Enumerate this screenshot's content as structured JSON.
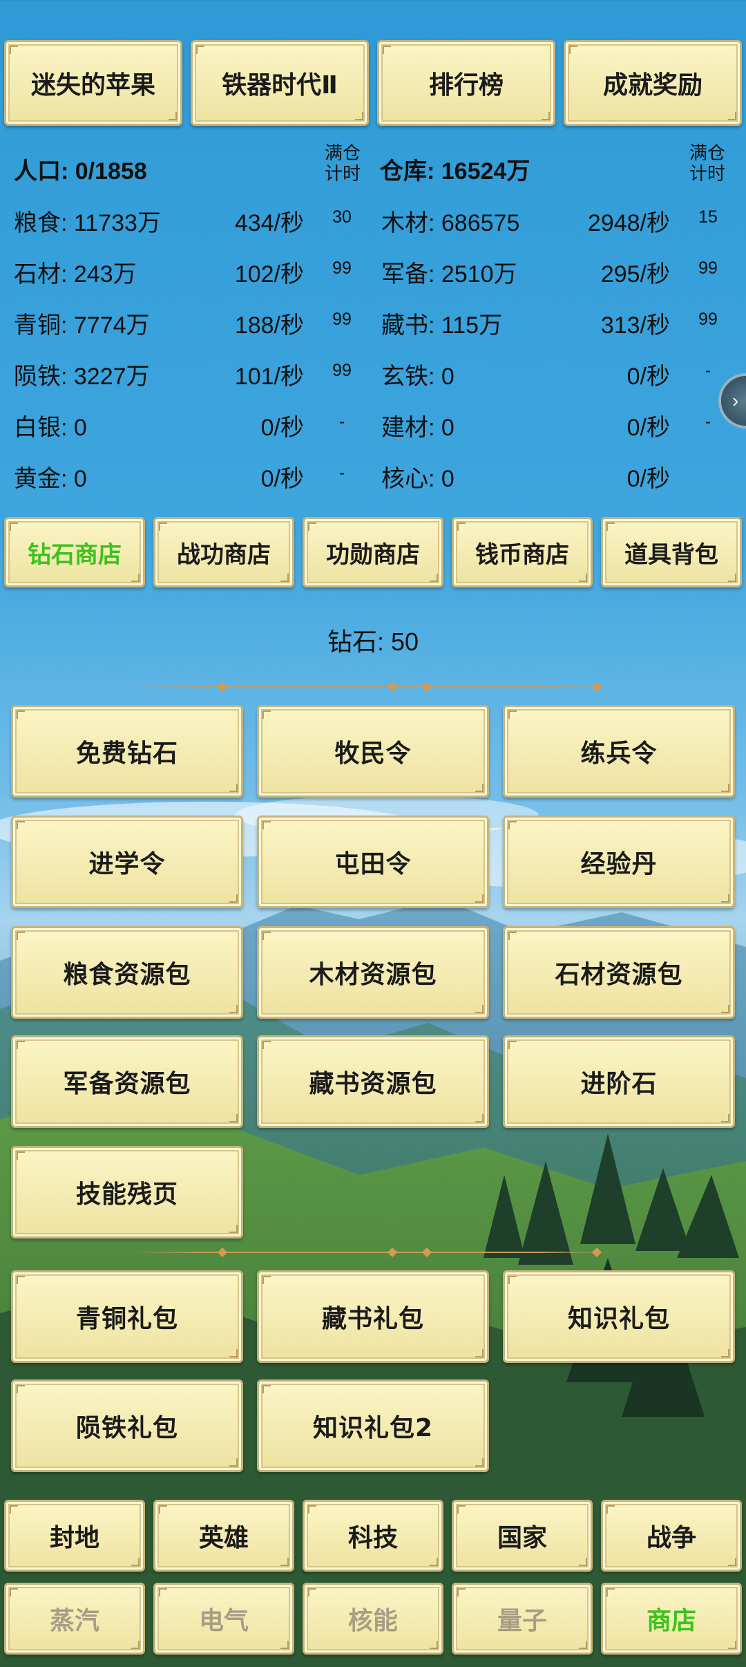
{
  "top_tabs": [
    "迷失的苹果",
    "铁器时代Ⅱ",
    "排行榜",
    "成就奖励"
  ],
  "resources": {
    "left_header": {
      "label": "人口: 0/1858",
      "cap_label": "满仓\n计时"
    },
    "right_header": {
      "label": "仓库: 16524万",
      "cap_label": "满仓\n计时"
    },
    "left": [
      {
        "name": "粮食: 11733万",
        "rate": "434/秒",
        "timer": "30"
      },
      {
        "name": "石材: 243万",
        "rate": "102/秒",
        "timer": "99"
      },
      {
        "name": "青铜: 7774万",
        "rate": "188/秒",
        "timer": "99"
      },
      {
        "name": "陨铁: 3227万",
        "rate": "101/秒",
        "timer": "99"
      },
      {
        "name": "白银: 0",
        "rate": "0/秒",
        "timer": "-"
      },
      {
        "name": "黄金: 0",
        "rate": "0/秒",
        "timer": "-"
      }
    ],
    "right": [
      {
        "name": "木材: 686575",
        "rate": "2948/秒",
        "timer": "15"
      },
      {
        "name": "军备: 2510万",
        "rate": "295/秒",
        "timer": "99"
      },
      {
        "name": "藏书: 115万",
        "rate": "313/秒",
        "timer": "99"
      },
      {
        "name": "玄铁: 0",
        "rate": "0/秒",
        "timer": "-"
      },
      {
        "name": "建材: 0",
        "rate": "0/秒",
        "timer": "-"
      },
      {
        "name": "核心: 0",
        "rate": "0/秒",
        "timer": ""
      }
    ]
  },
  "shop_tabs": [
    {
      "label": "钻石商店",
      "active": true
    },
    {
      "label": "战功商店",
      "active": false
    },
    {
      "label": "功勋商店",
      "active": false
    },
    {
      "label": "钱币商店",
      "active": false
    },
    {
      "label": "道具背包",
      "active": false
    }
  ],
  "diamonds_label": "钻石: 50",
  "items": [
    "免费钻石",
    "牧民令",
    "练兵令",
    "进学令",
    "屯田令",
    "经验丹",
    "粮食资源包",
    "木材资源包",
    "石材资源包",
    "军备资源包",
    "藏书资源包",
    "进阶石",
    "技能残页"
  ],
  "gifts": [
    "青铜礼包",
    "藏书礼包",
    "知识礼包",
    "陨铁礼包",
    "知识礼包2"
  ],
  "nav_row1": [
    "封地",
    "英雄",
    "科技",
    "国家",
    "战争"
  ],
  "nav_row2": [
    {
      "label": "蒸汽",
      "state": "dim"
    },
    {
      "label": "电气",
      "state": "dim"
    },
    {
      "label": "核能",
      "state": "dim"
    },
    {
      "label": "量子",
      "state": "dim"
    },
    {
      "label": "商店",
      "state": "active"
    }
  ],
  "colors": {
    "active_green": "#3cc21c",
    "dim_text": "#a89e85",
    "button_bg": "#f4ebb2"
  },
  "icons": {
    "side_handle": "chevron-right-icon"
  }
}
